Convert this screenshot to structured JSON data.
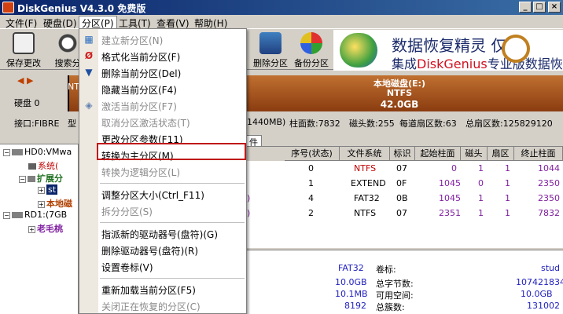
{
  "window": {
    "title": "DiskGenius V4.3.0 免费版",
    "min": "_",
    "max": "□",
    "close": "×"
  },
  "menubar": {
    "items": [
      "文件(F)",
      "硬盘(D)",
      "分区(P)",
      "工具(T)",
      "查看(V)",
      "帮助(H)"
    ]
  },
  "toolbar": {
    "save": "保存更改",
    "search": "搜索分",
    "delete": "删除分区",
    "backup": "备份分区"
  },
  "banner": {
    "line1": "数据恢复精灵",
    "line1b": "仅需",
    "line2a": "集成",
    "line2brand": "DiskGenius",
    "line2b": "专业版数据恢"
  },
  "diskbar": {
    "disk_label": "硬盘 0",
    "nt": "NT",
    "partition_name": "本地磁盘(E:)",
    "fs": "NTFS",
    "size": "42.0GB"
  },
  "infoline": {
    "iface": "接口:FIBRE",
    "model": "型",
    "capacity": "1440MB)",
    "cylinders": "柱面数:7832",
    "heads": "磁头数:255",
    "sectors_per_track": "每道扇区数:63",
    "total_sectors": "总扇区数:125829120"
  },
  "tree": {
    "hd0": "HD0:VMwa",
    "sys": "系统(",
    "ext": "扩展分",
    "st": "st",
    "local": "本地磁",
    "rd1": "RD1:(7GB",
    "old": "老毛桃"
  },
  "tab": {
    "label": "件"
  },
  "grid": {
    "headers": [
      "序号(状态)",
      "文件系统",
      "标识",
      "起始柱面",
      "磁头",
      "扇区",
      "终止柱面"
    ],
    "rows": [
      {
        "name": "",
        "idx": "0",
        "fs": "NTFS",
        "id": "07",
        "start": "0",
        "head": "1",
        "sector": "1",
        "end": "1044"
      },
      {
        "name": "",
        "idx": "1",
        "fs": "EXTEND",
        "id": "0F",
        "start": "1045",
        "head": "0",
        "sector": "1",
        "end": "2350"
      },
      {
        "name": ")",
        "idx": "4",
        "fs": "FAT32",
        "id": "0B",
        "start": "1045",
        "head": "1",
        "sector": "1",
        "end": "2350"
      },
      {
        "name": ")",
        "idx": "2",
        "fs": "NTFS",
        "id": "07",
        "start": "2351",
        "head": "1",
        "sector": "1",
        "end": "7832"
      }
    ]
  },
  "details": {
    "fs_value": "FAT32",
    "volume_label": "卷标:",
    "volume_value": "stud",
    "total_bytes_label": "总字节数:",
    "total_bytes_value": "1074218342",
    "free_label": "可用空间:",
    "free_value": "10.0GB",
    "size_a": "10.0GB",
    "size_b": "10.1MB",
    "clusters_label": "总簇数:",
    "clusters_value": "131002",
    "count": "8192",
    "partial": "2..."
  },
  "dropdown": {
    "items": [
      {
        "label": "建立新分区(N)",
        "disabled": true,
        "icon": "create-partition-icon",
        "glyph": "▦"
      },
      {
        "label": "格式化当前分区(F)",
        "disabled": false,
        "icon": "format-icon",
        "glyph": "Ø"
      },
      {
        "label": "删除当前分区(Del)",
        "disabled": false,
        "icon": "delete-icon",
        "glyph": "▼"
      },
      {
        "label": "隐藏当前分区(F4)",
        "disabled": false,
        "icon": "",
        "glyph": ""
      },
      {
        "label": "激活当前分区(F7)",
        "disabled": true,
        "icon": "activate-icon",
        "glyph": "◈"
      },
      {
        "label": "取消分区激活状态(T)",
        "disabled": true,
        "icon": "",
        "glyph": ""
      },
      {
        "label": "更改分区参数(F11)",
        "disabled": false,
        "icon": "",
        "glyph": ""
      },
      {
        "label": "转换为主分区(M)",
        "disabled": false,
        "icon": "",
        "glyph": ""
      },
      {
        "label": "转换为逻辑分区(L)",
        "disabled": true,
        "icon": "",
        "glyph": ""
      },
      {
        "label": "调整分区大小(Ctrl_F11)",
        "disabled": false,
        "icon": "",
        "glyph": ""
      },
      {
        "label": "拆分分区(S)",
        "disabled": true,
        "icon": "",
        "glyph": ""
      },
      {
        "label": "指派新的驱动器号(盘符)(G)",
        "disabled": false,
        "icon": "",
        "glyph": ""
      },
      {
        "label": "删除驱动器号(盘符)(R)",
        "disabled": false,
        "icon": "",
        "glyph": ""
      },
      {
        "label": "设置卷标(V)",
        "disabled": false,
        "icon": "",
        "glyph": ""
      },
      {
        "label": "重新加载当前分区(F5)",
        "disabled": false,
        "icon": "",
        "glyph": ""
      },
      {
        "label": "关闭正在恢复的分区(C)",
        "disabled": true,
        "icon": "",
        "glyph": ""
      }
    ]
  },
  "colors": {
    "highlight_border": "#c01818",
    "partition_bar": "#a0521c"
  }
}
